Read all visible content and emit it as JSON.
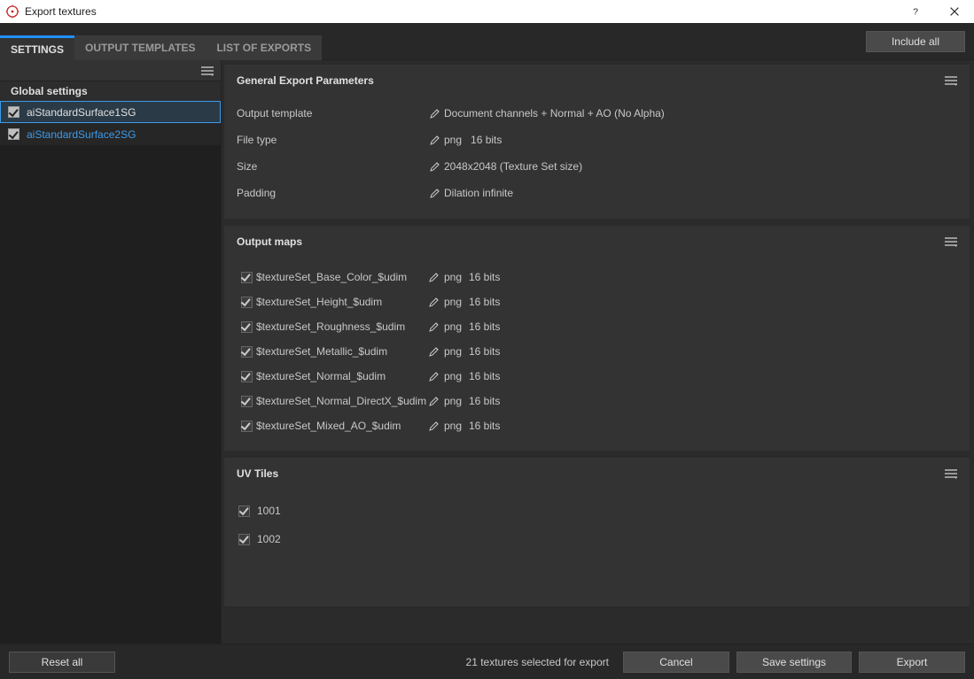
{
  "window": {
    "title": "Export textures"
  },
  "top": {
    "include_all": "Include all"
  },
  "tabs": [
    {
      "id": "settings",
      "label": "Settings",
      "active": true
    },
    {
      "id": "output_templates",
      "label": "Output Templates",
      "active": false
    },
    {
      "id": "list_of_exports",
      "label": "List of Exports",
      "active": false
    }
  ],
  "sidebar": {
    "global_label": "Global settings",
    "items": [
      {
        "id": "aiStandardSurface1SG",
        "label": "aiStandardSurface1SG",
        "checked": true,
        "selected": true,
        "accent": false
      },
      {
        "id": "aiStandardSurface2SG",
        "label": "aiStandardSurface2SG",
        "checked": true,
        "selected": false,
        "accent": true
      }
    ]
  },
  "general": {
    "title": "General Export Parameters",
    "rows": [
      {
        "label": "Output template",
        "value": "Document channels + Normal + AO (No Alpha)",
        "extra": ""
      },
      {
        "label": "File type",
        "value": "png",
        "extra": "16 bits"
      },
      {
        "label": "Size",
        "value": "2048x2048 (Texture Set size)",
        "extra": ""
      },
      {
        "label": "Padding",
        "value": "Dilation infinite",
        "extra": ""
      }
    ]
  },
  "output_maps": {
    "title": "Output maps",
    "maps": [
      {
        "checked": true,
        "name": "$textureSet_Base_Color_$udim",
        "format": "png",
        "bits": "16 bits"
      },
      {
        "checked": true,
        "name": "$textureSet_Height_$udim",
        "format": "png",
        "bits": "16 bits"
      },
      {
        "checked": true,
        "name": "$textureSet_Roughness_$udim",
        "format": "png",
        "bits": "16 bits"
      },
      {
        "checked": true,
        "name": "$textureSet_Metallic_$udim",
        "format": "png",
        "bits": "16 bits"
      },
      {
        "checked": true,
        "name": "$textureSet_Normal_$udim",
        "format": "png",
        "bits": "16 bits"
      },
      {
        "checked": true,
        "name": "$textureSet_Normal_DirectX_$udim",
        "format": "png",
        "bits": "16 bits"
      },
      {
        "checked": true,
        "name": "$textureSet_Mixed_AO_$udim",
        "format": "png",
        "bits": "16 bits"
      }
    ]
  },
  "uv_tiles": {
    "title": "UV Tiles",
    "tiles": [
      {
        "checked": true,
        "id": "1001"
      },
      {
        "checked": true,
        "id": "1002"
      }
    ]
  },
  "bottom": {
    "reset": "Reset all",
    "status": "21 textures selected for export",
    "cancel": "Cancel",
    "save": "Save settings",
    "export": "Export"
  }
}
